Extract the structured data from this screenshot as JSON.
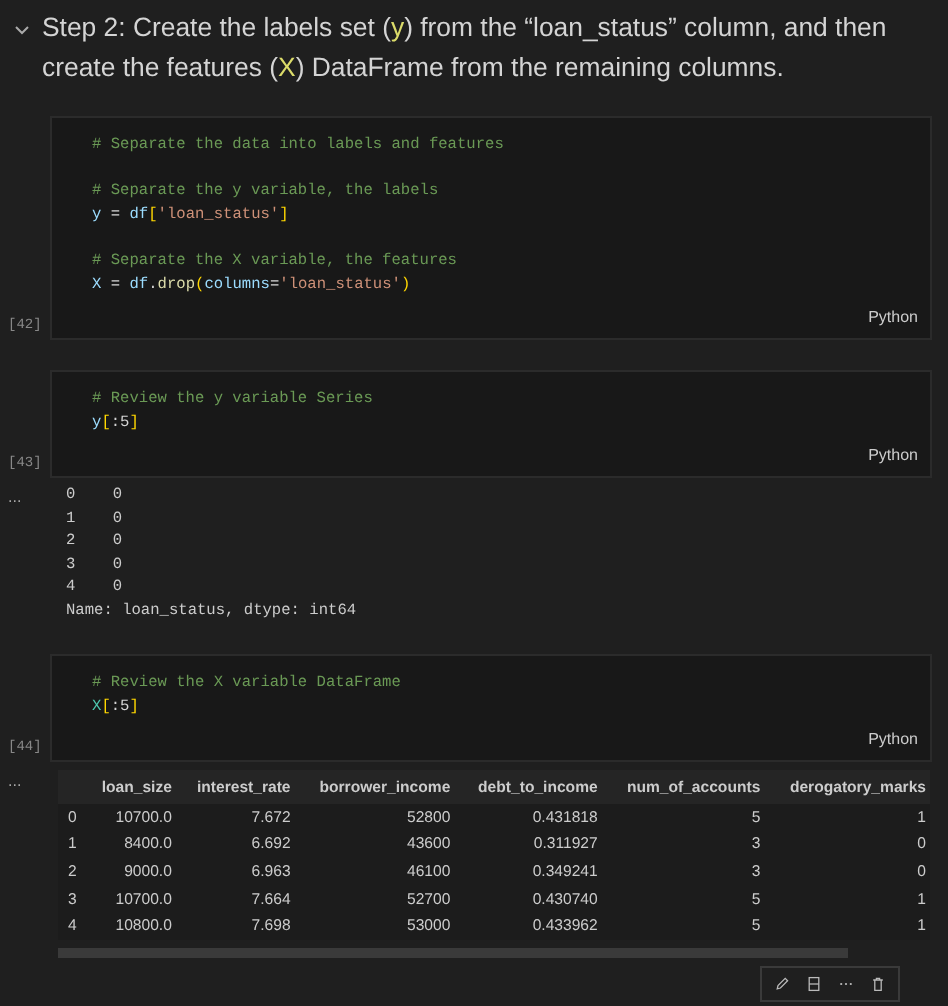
{
  "heading": {
    "expanded": true,
    "segments": [
      {
        "kind": "plain",
        "text": "Step 2: Create the labels set ("
      },
      {
        "kind": "var",
        "text": "y"
      },
      {
        "kind": "plain",
        "text": ") from the “loan_status” column, and then create the features ("
      },
      {
        "kind": "var",
        "text": "X"
      },
      {
        "kind": "plain",
        "text": ") DataFrame from the remaining columns."
      }
    ]
  },
  "cells": [
    {
      "execution_count": "[42]",
      "language": "Python",
      "lines": [
        {
          "kind": "code",
          "tokens": [
            {
              "kind": "comment",
              "text": "# Separate the data into labels and features"
            }
          ]
        },
        {
          "kind": "blank"
        },
        {
          "kind": "code",
          "tokens": [
            {
              "kind": "comment",
              "text": "# Separate the y variable, the labels"
            }
          ]
        },
        {
          "kind": "code",
          "tokens": [
            {
              "kind": "name",
              "text": "y"
            },
            {
              "kind": "op",
              "text": " = "
            },
            {
              "kind": "name",
              "text": "df"
            },
            {
              "kind": "bracket",
              "text": "["
            },
            {
              "kind": "string",
              "text": "'loan_status'"
            },
            {
              "kind": "bracket",
              "text": "]"
            }
          ]
        },
        {
          "kind": "blank"
        },
        {
          "kind": "code",
          "tokens": [
            {
              "kind": "comment",
              "text": "# Separate the X variable, the features"
            }
          ]
        },
        {
          "kind": "code",
          "tokens": [
            {
              "kind": "name",
              "text": "X"
            },
            {
              "kind": "op",
              "text": " = "
            },
            {
              "kind": "name",
              "text": "df"
            },
            {
              "kind": "op",
              "text": "."
            },
            {
              "kind": "func",
              "text": "drop"
            },
            {
              "kind": "bracket",
              "text": "("
            },
            {
              "kind": "name",
              "text": "columns"
            },
            {
              "kind": "op",
              "text": "="
            },
            {
              "kind": "string",
              "text": "'loan_status'"
            },
            {
              "kind": "bracket",
              "text": ")"
            }
          ]
        }
      ]
    },
    {
      "execution_count": "[43]",
      "language": "Python",
      "lines": [
        {
          "kind": "code",
          "tokens": [
            {
              "kind": "comment",
              "text": "# Review the y variable Series"
            }
          ]
        },
        {
          "kind": "code",
          "tokens": [
            {
              "kind": "name",
              "text": "y"
            },
            {
              "kind": "bracket",
              "text": "["
            },
            {
              "kind": "op",
              "text": ":5"
            },
            {
              "kind": "bracket",
              "text": "]"
            }
          ]
        }
      ],
      "output": {
        "kind": "text",
        "marker": "...",
        "lines": [
          "0    0",
          "1    0",
          "2    0",
          "3    0",
          "4    0",
          "Name: loan_status, dtype: int64"
        ]
      }
    },
    {
      "execution_count": "[44]",
      "language": "Python",
      "lines": [
        {
          "kind": "code",
          "tokens": [
            {
              "kind": "comment",
              "text": "# Review the X variable DataFrame"
            }
          ]
        },
        {
          "kind": "code",
          "tokens": [
            {
              "kind": "classname",
              "text": "X"
            },
            {
              "kind": "bracket",
              "text": "["
            },
            {
              "kind": "op",
              "text": ":5"
            },
            {
              "kind": "bracket",
              "text": "]"
            }
          ]
        }
      ],
      "output": {
        "kind": "table",
        "marker": "...",
        "columns": [
          "loan_size",
          "interest_rate",
          "borrower_income",
          "debt_to_income",
          "num_of_accounts",
          "derogatory_marks"
        ],
        "rows": [
          {
            "index": "0",
            "cells": [
              "10700.0",
              "7.672",
              "52800",
              "0.431818",
              "5",
              "1"
            ]
          },
          {
            "index": "1",
            "cells": [
              "8400.0",
              "6.692",
              "43600",
              "0.311927",
              "3",
              "0"
            ]
          },
          {
            "index": "2",
            "cells": [
              "9000.0",
              "6.963",
              "46100",
              "0.349241",
              "3",
              "0"
            ]
          },
          {
            "index": "3",
            "cells": [
              "10700.0",
              "7.664",
              "52700",
              "0.430740",
              "5",
              "1"
            ]
          },
          {
            "index": "4",
            "cells": [
              "10800.0",
              "7.698",
              "53000",
              "0.433962",
              "5",
              "1"
            ]
          }
        ]
      }
    }
  ]
}
